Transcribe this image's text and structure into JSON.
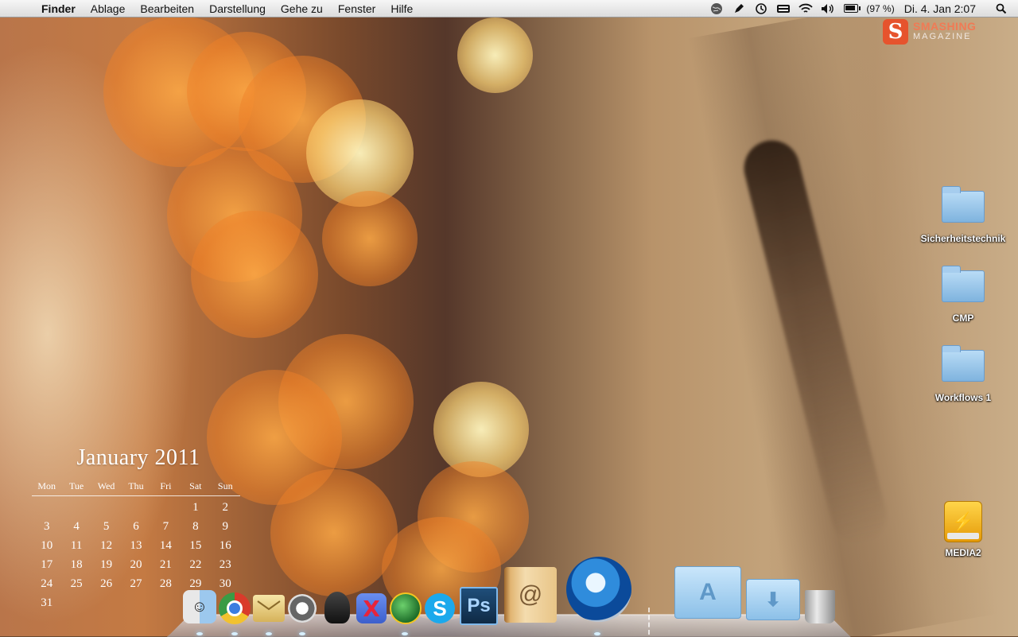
{
  "menubar": {
    "apple_glyph": "",
    "items": [
      "Finder",
      "Ablage",
      "Bearbeiten",
      "Darstellung",
      "Gehe zu",
      "Fenster",
      "Hilfe"
    ],
    "battery_percent_text": "(97 %)",
    "battery_level": 0.97,
    "clock": "Di. 4. Jan  2:07",
    "status_icons": [
      "globe-icon",
      "pen-icon",
      "time-machine-icon",
      "keyboard-icon",
      "wifi-icon",
      "volume-icon",
      "battery-icon"
    ]
  },
  "logo": {
    "badge": "S",
    "line1": "SMASHING",
    "line2": "MAGAZINE"
  },
  "desktop_icons": [
    {
      "label": "Sicherheitstechnik",
      "type": "folder"
    },
    {
      "label": "CMP",
      "type": "folder"
    },
    {
      "label": "Workflows 1",
      "type": "folder"
    },
    {
      "label": "MEDIA2",
      "type": "usb-drive"
    }
  ],
  "calendar": {
    "title": "January 2011",
    "weekdays": [
      "Mon",
      "Tue",
      "Wed",
      "Thu",
      "Fri",
      "Sat",
      "Sun"
    ],
    "days": [
      "",
      "",
      "",
      "",
      "",
      "1",
      "2",
      "3",
      "4",
      "5",
      "6",
      "7",
      "8",
      "9",
      "10",
      "11",
      "12",
      "13",
      "14",
      "15",
      "16",
      "17",
      "18",
      "19",
      "20",
      "21",
      "22",
      "23",
      "24",
      "25",
      "26",
      "27",
      "28",
      "29",
      "30",
      "31",
      "",
      "",
      "",
      "",
      "",
      ""
    ]
  },
  "dock": {
    "items": [
      "finder",
      "chrome",
      "mail",
      "headphones",
      "spy",
      "x-app",
      "globe",
      "skype",
      "photoshop",
      "address-book",
      "quicktime",
      "applications-folder",
      "downloads-folder",
      "trash"
    ],
    "glyphs": {
      "ps": "Ps",
      "address_book": "@",
      "skype": "S",
      "x_app": "X"
    }
  },
  "colors": {
    "menubar_top": "#f6f6f6",
    "folder_blue": "#8fc0e8",
    "logo_orange": "#e6532d"
  }
}
